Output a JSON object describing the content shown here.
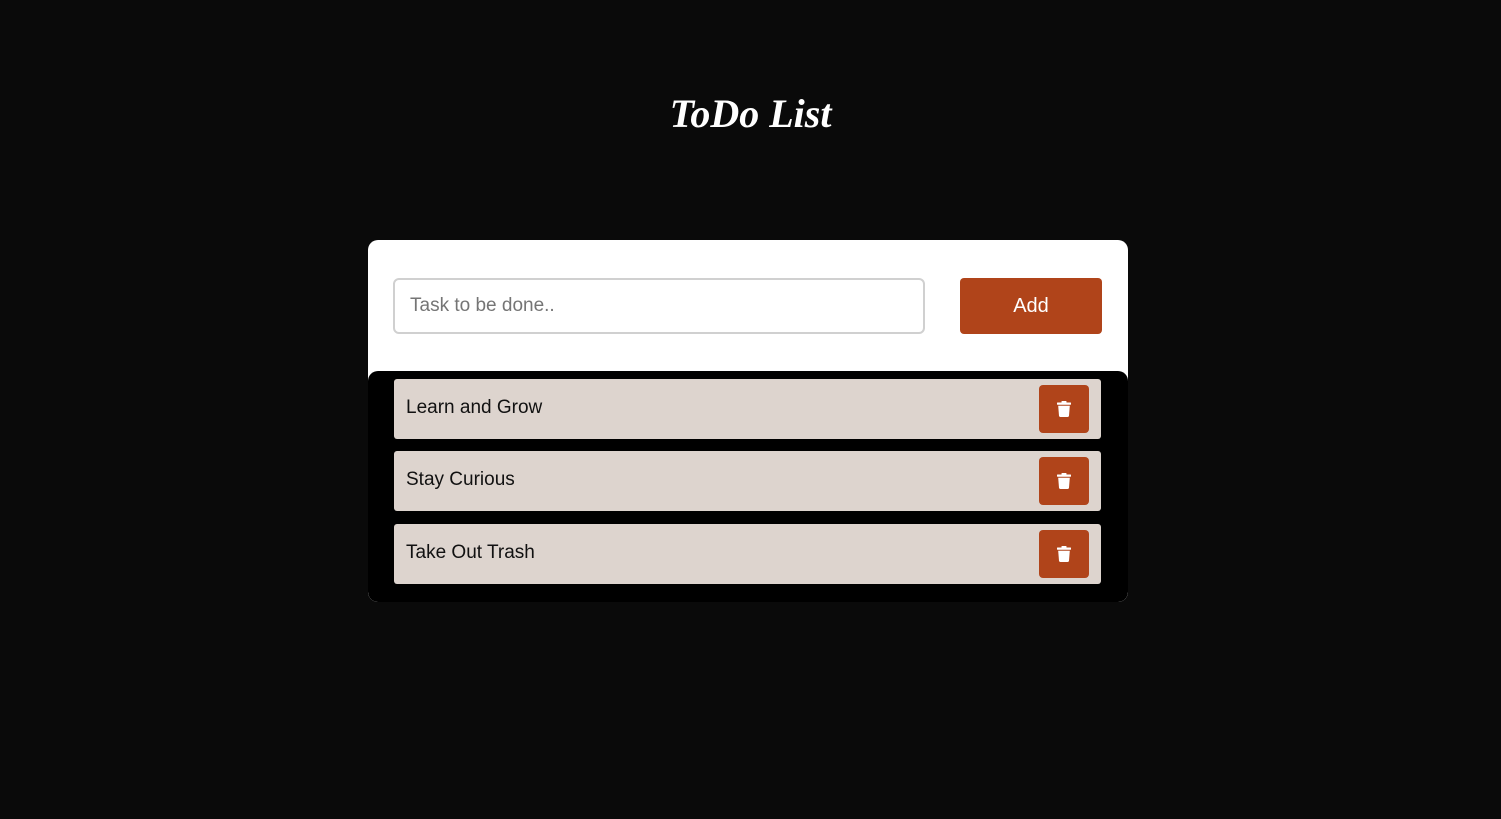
{
  "header": {
    "title": "ToDo List"
  },
  "form": {
    "input_value": "",
    "input_placeholder": "Task to be done..",
    "add_label": "Add"
  },
  "tasks": [
    {
      "label": "Learn and Grow",
      "icon": "trash-icon"
    },
    {
      "label": "Stay Curious",
      "icon": "trash-icon"
    },
    {
      "label": "Take Out Trash",
      "icon": "trash-icon"
    }
  ],
  "colors": {
    "background": "#0a0a0a",
    "card": "#ffffff",
    "accent": "#b0441a",
    "item": "#ddd4ce",
    "list_panel": "#000000"
  }
}
